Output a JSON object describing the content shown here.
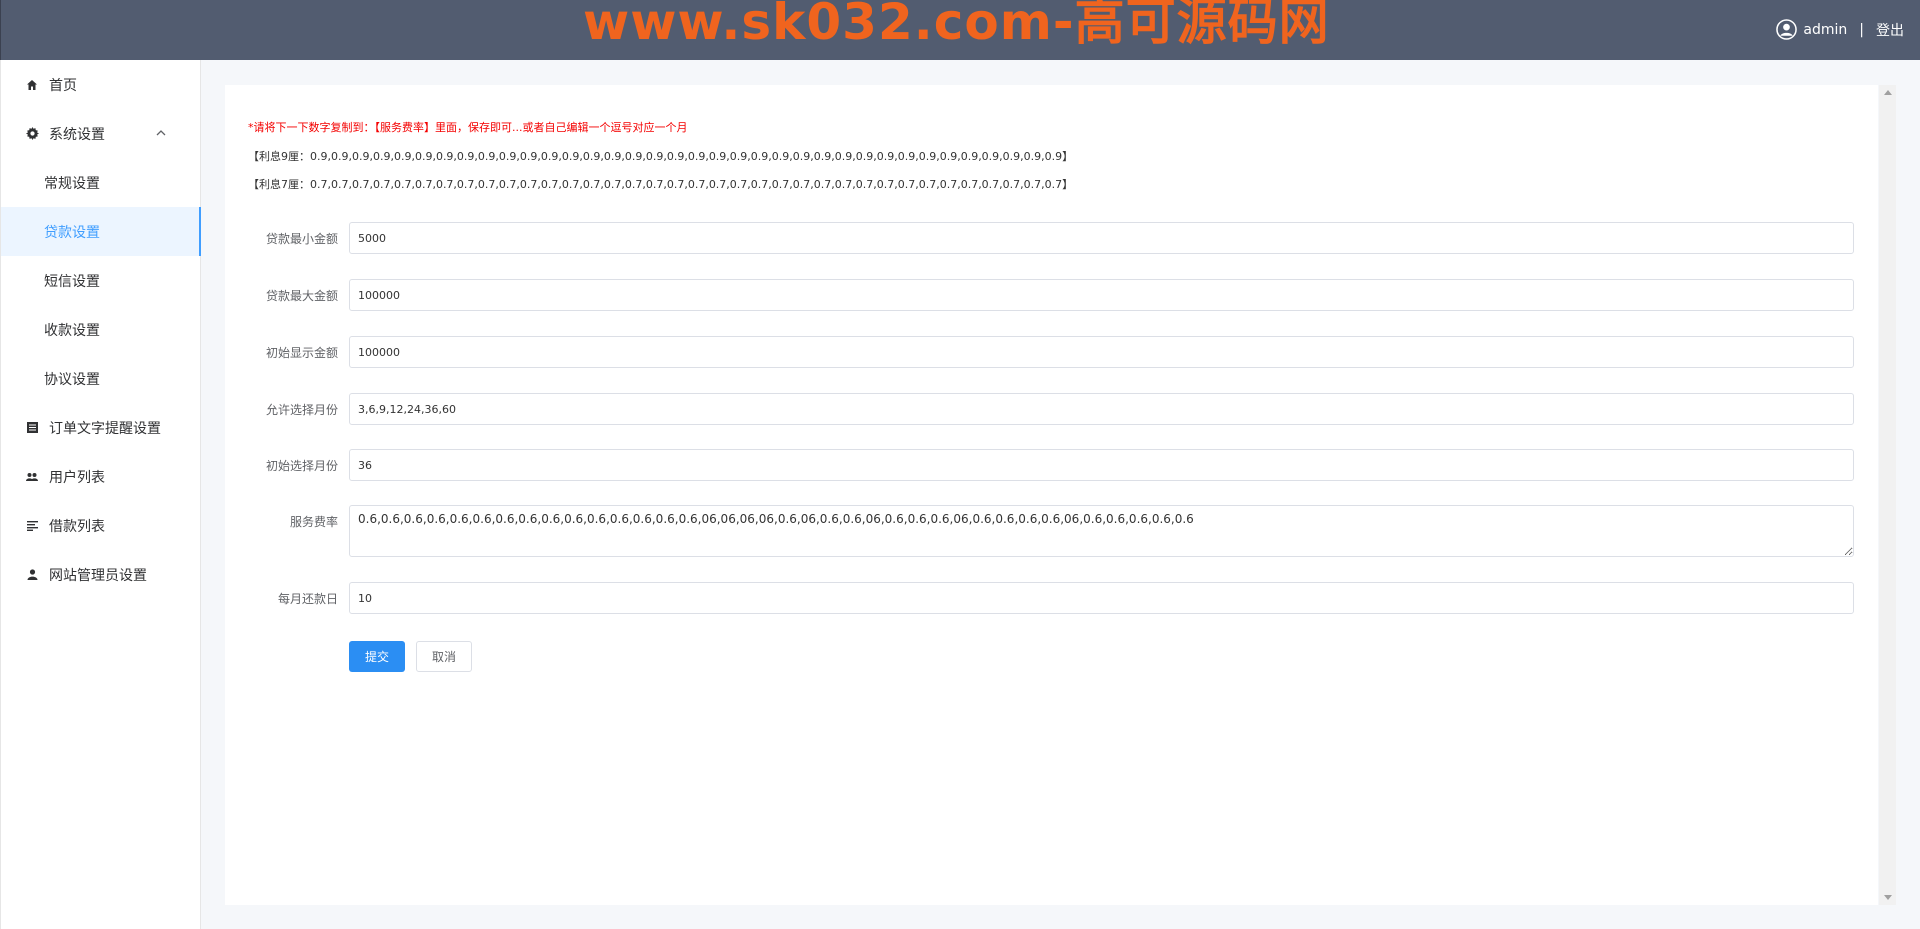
{
  "header": {
    "watermark": "www.sk032.com-高可源码网",
    "username": "admin",
    "separator": "|",
    "logout_label": "登出"
  },
  "sidebar": {
    "items": [
      {
        "label": "首页",
        "icon": "home-icon"
      },
      {
        "label": "系统设置",
        "icon": "gear-icon"
      },
      {
        "label": "常规设置"
      },
      {
        "label": "贷款设置"
      },
      {
        "label": "短信设置"
      },
      {
        "label": "收款设置"
      },
      {
        "label": "协议设置"
      },
      {
        "label": "订单文字提醒设置",
        "icon": "list-icon"
      },
      {
        "label": "用户列表",
        "icon": "users-icon"
      },
      {
        "label": "借款列表",
        "icon": "lines-icon"
      },
      {
        "label": "网站管理员设置",
        "icon": "user-icon"
      }
    ],
    "active_item": "贷款设置"
  },
  "content": {
    "notice": "*请将下一下数字复制到：【服务费率】里面，保存即可...或者自己编辑一个逗号对应一个月",
    "rate_9": "【利息9厘：0.9,0.9,0.9,0.9,0.9,0.9,0.9,0.9,0.9,0.9,0.9,0.9,0.9,0.9,0.9,0.9,0.9,0.9,0.9,0.9,0.9,0.9,0.9,0.9,0.9,0.9,0.9,0.9,0.9,0.9,0.9,0.9,0.9,0.9,0.9,0.9】",
    "rate_7": "【利息7厘：0.7,0.7,0.7,0.7,0.7,0.7,0.7,0.7,0.7,0.7,0.7,0.7,0.7,0.7,0.7,0.7,0.7,0.7,0.7,0.7,0.7,0.7,0.7,0.7,0.7,0.7,0.7,0.7,0.7,0.7,0.7,0.7,0.7,0.7,0.7,0.7】"
  },
  "form": {
    "min_amount": {
      "label": "贷款最小金额",
      "value": "5000"
    },
    "max_amount": {
      "label": "贷款最大金额",
      "value": "100000"
    },
    "initial_amount": {
      "label": "初始显示金额",
      "value": "100000"
    },
    "allowed_months": {
      "label": "允许选择月份",
      "value": "3,6,9,12,24,36,60"
    },
    "initial_month": {
      "label": "初始选择月份",
      "value": "36"
    },
    "service_rate": {
      "label": "服务费率",
      "value": "0.6,0.6,0.6,0.6,0.6,0.6,0.6,0.6,0.6,0.6,0.6,0.6,0.6,0.6,0.6,06,06,06,06,0.6,06,0.6,0.6,06,0.6,0.6,0.6,06,0.6,0.6,0.6,0.6,06,0.6,0.6,0.6,0.6,0.6"
    },
    "repay_day": {
      "label": "每月还款日",
      "value": "10"
    },
    "submit_label": "提交",
    "cancel_label": "取消"
  },
  "colors": {
    "header_bg": "#525c70",
    "watermark": "#f0641e",
    "accent": "#409eff",
    "submit_bg": "#2b8ef3",
    "notice": "#f40000"
  }
}
